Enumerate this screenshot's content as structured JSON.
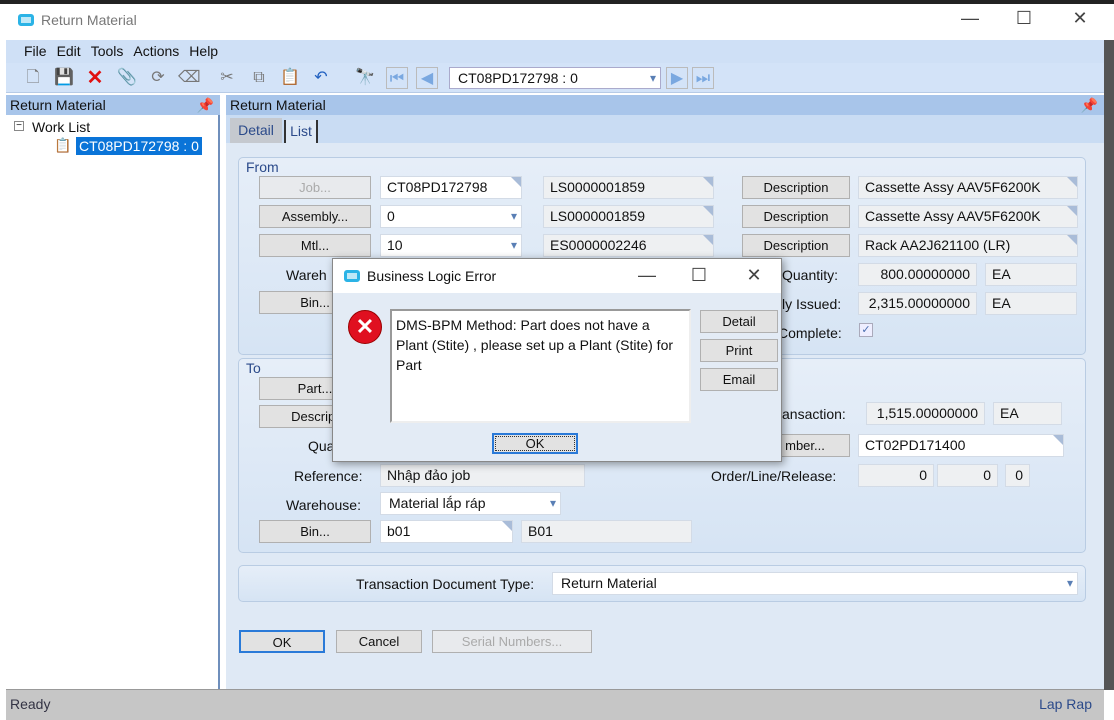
{
  "window": {
    "title": "Return Material",
    "minimize": "—",
    "maximize": "☐",
    "close": "✕"
  },
  "menu": [
    "File",
    "Edit",
    "Tools",
    "Actions",
    "Help"
  ],
  "toolbar": {
    "record_selector": "CT08PD172798  : 0"
  },
  "left_panel": {
    "title": "Return Material",
    "tree_root": "Work List",
    "tree_item": "CT08PD172798  : 0"
  },
  "right_panel": {
    "title": "Return Material",
    "tabs": [
      "Detail",
      "List"
    ]
  },
  "from": {
    "label": "From",
    "job_btn": "Job...",
    "job": "CT08PD172798",
    "job_part": "LS0000001859",
    "assembly_btn": "Assembly...",
    "assembly": "0",
    "assembly_part": "LS0000001859",
    "mtl_btn": "Mtl...",
    "mtl": "10",
    "mtl_part": "ES0000002246",
    "desc_btn": "Description",
    "desc1": "Cassette Assy AAV5F6200K",
    "desc2": "Cassette Assy AAV5F6200K",
    "desc3": "Rack AA2J621100 (LR)",
    "warehouse_lbl": "Wareh",
    "bin_btn": "Bin...",
    "quantity_lbl": "Quantity:",
    "quantity": "800.00000000",
    "quantity_uom": "EA",
    "issued_lbl": "ly Issued:",
    "issued": "2,315.00000000",
    "issued_uom": "EA",
    "complete_lbl": "Complete:",
    "complete": true
  },
  "to": {
    "label": "To",
    "part_btn": "Part...",
    "desc_btn": "Descript",
    "qty_lbl": "Qua",
    "transaction_lbl": "ansaction:",
    "transaction_qty": "1,515.00000000",
    "transaction_uom": "EA",
    "number_btn": "mber...",
    "number": "CT02PD171400",
    "reference_lbl": "Reference:",
    "reference": "Nhập đảo job",
    "olr_lbl": "Order/Line/Release:",
    "order": "0",
    "line": "0",
    "release": "0",
    "warehouse_lbl": "Warehouse:",
    "warehouse": "Material lắp ráp",
    "bin_btn": "Bin...",
    "bin": "b01",
    "bin_desc": "B01"
  },
  "doc_type": {
    "label": "Transaction Document Type:",
    "value": "Return Material"
  },
  "actions": {
    "ok": "OK",
    "cancel": "Cancel",
    "serial": "Serial Numbers..."
  },
  "status": {
    "left": "Ready",
    "right": "Lap Rap"
  },
  "dialog": {
    "title": "Business Logic Error",
    "message": "DMS-BPM Method: Part   does not have a Plant (Stite) , please set up a Plant (Stite) for Part",
    "detail": "Detail",
    "print": "Print",
    "email": "Email",
    "ok": "OK",
    "minimize": "—",
    "maximize": "☐",
    "close": "✕"
  }
}
